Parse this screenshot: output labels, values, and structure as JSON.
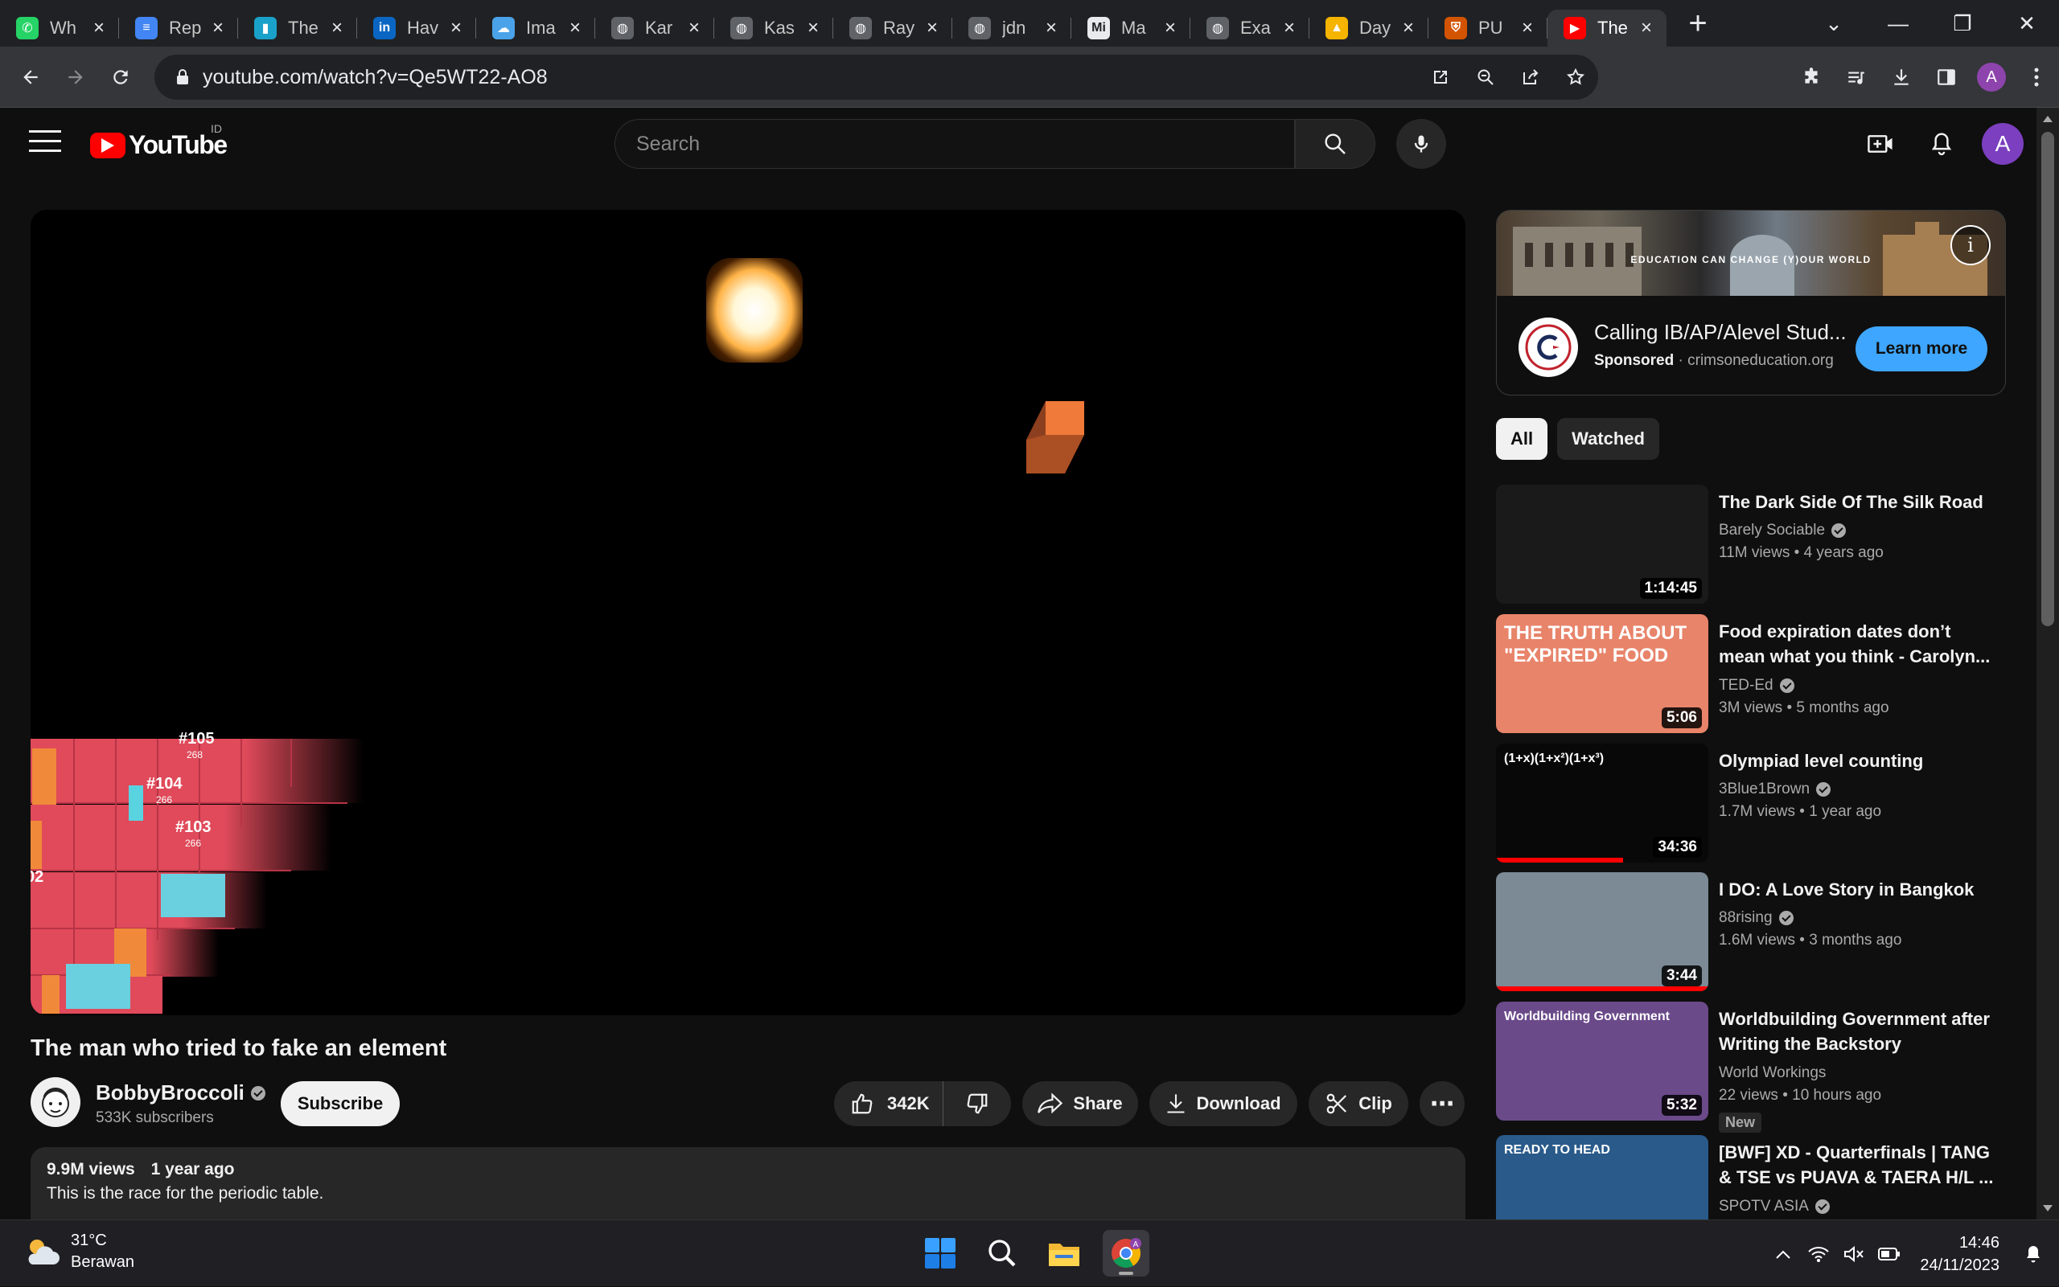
{
  "browser": {
    "tabs": [
      {
        "label": "Wh",
        "icon": "whatsapp-icon",
        "color": "#25d366",
        "glyph": "✆"
      },
      {
        "label": "Rep",
        "icon": "google-docs-icon",
        "color": "#4285f4",
        "glyph": "≡"
      },
      {
        "label": "The",
        "icon": "chart-icon",
        "color": "#1aa1c9",
        "glyph": "▮"
      },
      {
        "label": "Hav",
        "icon": "linkedin-icon",
        "color": "#0a66c2",
        "glyph": "in"
      },
      {
        "label": "Ima",
        "icon": "cloud-icon",
        "color": "#4aa3e8",
        "glyph": "☁"
      },
      {
        "label": "Kar",
        "icon": "globe-icon",
        "color": "#5f6368",
        "glyph": "◍"
      },
      {
        "label": "Kas",
        "icon": "globe-icon",
        "color": "#5f6368",
        "glyph": "◍"
      },
      {
        "label": "Ray",
        "icon": "globe-icon",
        "color": "#5f6368",
        "glyph": "◍"
      },
      {
        "label": "jdn",
        "icon": "globe-icon",
        "color": "#5f6368",
        "glyph": "◍"
      },
      {
        "label": "Ma",
        "icon": "mi-icon",
        "color": "#e8eaed",
        "glyph": "Mi"
      },
      {
        "label": "Exa",
        "icon": "globe-icon",
        "color": "#5f6368",
        "glyph": "◍"
      },
      {
        "label": "Day",
        "icon": "google-drive-icon",
        "color": "#f4b400",
        "glyph": "▲"
      },
      {
        "label": "PU",
        "icon": "shield-crest-icon",
        "color": "#d35400",
        "glyph": "⛨"
      },
      {
        "label": "The",
        "icon": "youtube-icon",
        "color": "#ff0000",
        "glyph": "▶",
        "active": true
      }
    ],
    "url": "youtube.com/watch?v=Qe5WT22-AO8",
    "profile_initial": "A"
  },
  "youtube": {
    "logo_text": "YouTube",
    "country_code": "ID",
    "search_placeholder": "Search",
    "avatar_initial": "A"
  },
  "video": {
    "title": "The man who tried to fake an element",
    "channel": "BobbyBroccoli",
    "subscribers": "533K subscribers",
    "subscribe_label": "Subscribe",
    "likes": "342K",
    "share_label": "Share",
    "download_label": "Download",
    "clip_label": "Clip",
    "views": "9.9M views",
    "age": "1 year ago",
    "description": "This is the race for the periodic table.",
    "frame_labels": {
      "a": "#105",
      "a_sub": "268",
      "b": "#104",
      "b_sub": "266",
      "c": "#103",
      "c_sub": "266",
      "d": "02"
    }
  },
  "ad": {
    "banner_text": "EDUCATION CAN CHANGE (Y)OUR WORLD",
    "title": "Calling IB/AP/Alevel Stud...",
    "sponsored": "Sponsored",
    "domain": "crimsoneducation.org",
    "cta": "Learn more",
    "info_glyph": "i"
  },
  "chips": [
    "All",
    "Watched"
  ],
  "recommendations": [
    {
      "title": "The Dark Side Of The Silk Road",
      "channel": "Barely Sociable",
      "verified": true,
      "views": "11M views",
      "age": "4 years ago",
      "duration": "1:14:45",
      "thumb_color": "#1a1a1a",
      "thumb_caption": ""
    },
    {
      "title": "Food expiration dates don’t mean what you think - Carolyn...",
      "channel": "TED-Ed",
      "verified": true,
      "views": "3M views",
      "age": "5 months ago",
      "duration": "5:06",
      "thumb_color": "#e8846a",
      "thumb_caption": "THE TRUTH ABOUT \"EXPIRED\" FOOD"
    },
    {
      "title": "Olympiad level counting",
      "channel": "3Blue1Brown",
      "verified": true,
      "views": "1.7M views",
      "age": "1 year ago",
      "duration": "34:36",
      "thumb_color": "#080808",
      "thumb_caption": "(1+x)(1+x²)(1+x³)",
      "progress": 0.6
    },
    {
      "title": "I DO: A Love Story in Bangkok",
      "channel": "88rising",
      "verified": true,
      "views": "1.6M views",
      "age": "3 months ago",
      "duration": "3:44",
      "thumb_color": "#7b8a95",
      "thumb_caption": "",
      "progress": 1.0
    },
    {
      "title": "Worldbuilding Government after Writing the Backstory",
      "channel": "World Workings",
      "verified": false,
      "views": "22 views",
      "age": "10 hours ago",
      "duration": "5:32",
      "thumb_color": "#6b4a8a",
      "thumb_caption": "Worldbuilding Government",
      "badge": "New"
    },
    {
      "title": "[BWF] XD - Quarterfinals | TANG & TSE vs PUAVA & TAERA H/L ...",
      "channel": "SPOTV ASIA",
      "verified": true,
      "views": "",
      "age": "",
      "duration": "",
      "thumb_color": "#2a5a8a",
      "thumb_caption": "READY TO HEAD"
    }
  ],
  "taskbar": {
    "temperature": "31°C",
    "weather": "Berawan",
    "time": "14:46",
    "date": "24/11/2023"
  }
}
